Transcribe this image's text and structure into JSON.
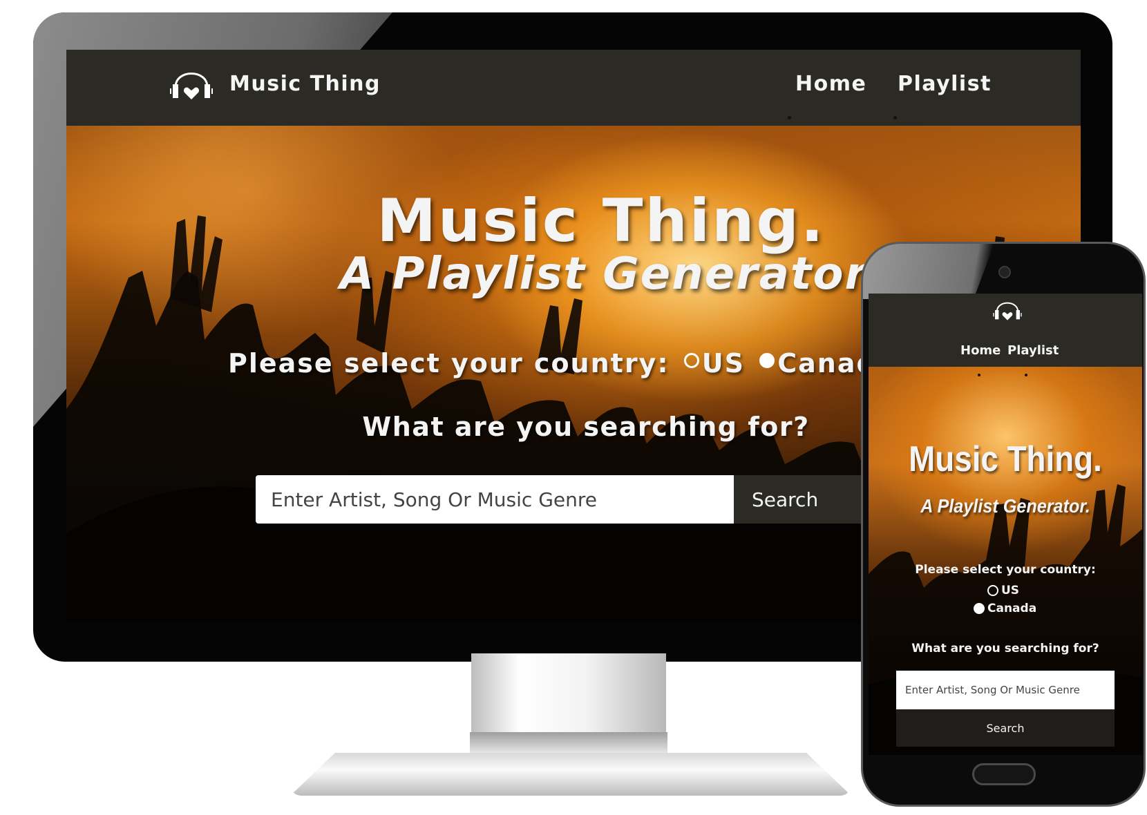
{
  "desktop": {
    "nav": {
      "brand": "Music Thing",
      "links": [
        {
          "label": "Home"
        },
        {
          "label": "Playlist"
        }
      ]
    },
    "hero": {
      "title": "Music Thing.",
      "subtitle": "A Playlist Generator.",
      "country_prompt": "Please select your country:",
      "country_options": [
        {
          "label": "US",
          "checked": false
        },
        {
          "label": "Canada",
          "checked": true
        }
      ],
      "question": "What are you searching for?"
    },
    "search": {
      "placeholder": "Enter Artist, Song Or Music Genre",
      "button_label": "Search"
    }
  },
  "mobile": {
    "nav": {
      "links": [
        {
          "label": "Home"
        },
        {
          "label": "Playlist"
        }
      ]
    },
    "hero": {
      "title": "Music Thing.",
      "subtitle": "A Playlist Generator.",
      "country_prompt": "Please select your country:",
      "country_options": [
        {
          "label": "US",
          "checked": false
        },
        {
          "label": "Canada",
          "checked": true
        }
      ],
      "question": "What are you searching for?"
    },
    "search": {
      "placeholder": "Enter Artist, Song Or Music Genre",
      "button_label": "Search"
    }
  },
  "icons": {
    "logo": "headphones-heart-icon",
    "radio": "radio-button-icon"
  },
  "colors": {
    "nav_bg": "#2b2a24",
    "hero_accent": "#e08a1e",
    "text": "#f4f4f4",
    "device_frame": "#050505"
  }
}
